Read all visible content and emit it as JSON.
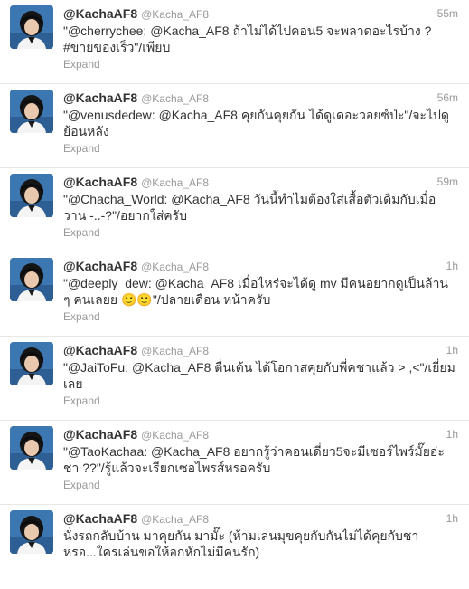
{
  "tweets": [
    {
      "name": "@KachaAF8",
      "handle": "@Kacha_AF8",
      "time": "55m",
      "text": "\"@cherrychee: @Kacha_AF8 ถ้าไม่ได้ไปคอน5 จะพลาดอะไรบ้าง ? #ขายของเร็ว\"/เพียบ",
      "action": "Expand"
    },
    {
      "name": "@KachaAF8",
      "handle": "@Kacha_AF8",
      "time": "56m",
      "text": "\"@venusdedew: @Kacha_AF8 คุยกันคุยกัน ได้ดูเดอะวอยซ์ป่ะ\"/จะไปดูย้อนหลัง",
      "action": "Expand"
    },
    {
      "name": "@KachaAF8",
      "handle": "@Kacha_AF8",
      "time": "59m",
      "text": "\"@Chacha_World: @Kacha_AF8 วันนี้ทำไมต้องใส่เสื้อตัวเดิมกับเมื่อวาน -..-?\"/อยากใส่ครับ",
      "action": "Expand"
    },
    {
      "name": "@KachaAF8",
      "handle": "@Kacha_AF8",
      "time": "1h",
      "text": "\"@deeply_dew: @Kacha_AF8 เมื่อไหร่จะได้ดู mv มีคนอยากดูเป็นล้าน ๆ คนเลยย 🙂🙂\"/ปลายเดือน หน้าครับ",
      "action": "Expand"
    },
    {
      "name": "@KachaAF8",
      "handle": "@Kacha_AF8",
      "time": "1h",
      "text": "\"@JaiToFu: @Kacha_AF8 ตื่นเต้น ได้โอกาสคุยกับพี่คชาแล้ว > ,<\"/เยี่ยมเลย",
      "action": "Expand"
    },
    {
      "name": "@KachaAF8",
      "handle": "@Kacha_AF8",
      "time": "1h",
      "text": "\"@TaoKachaa: @Kacha_AF8 อยากรู้ว่าคอนเดี่ยว5จะมีเซอร์ไพร์มั๊ยอ่ะชา ??\"/รู้แล้วจะเรียกเซอไพรส์หรอครับ",
      "action": "Expand"
    },
    {
      "name": "@KachaAF8",
      "handle": "@Kacha_AF8",
      "time": "1h",
      "text": "นั่งรถกลับบ้าน มาคุยกัน มามั๊ะ (ห้ามเล่นมุขคุยกับกันไม่ได้คุยกับชาหรอ...ใครเล่นขอให้อกหักไม่มีคนรัก)",
      "action": ""
    }
  ]
}
